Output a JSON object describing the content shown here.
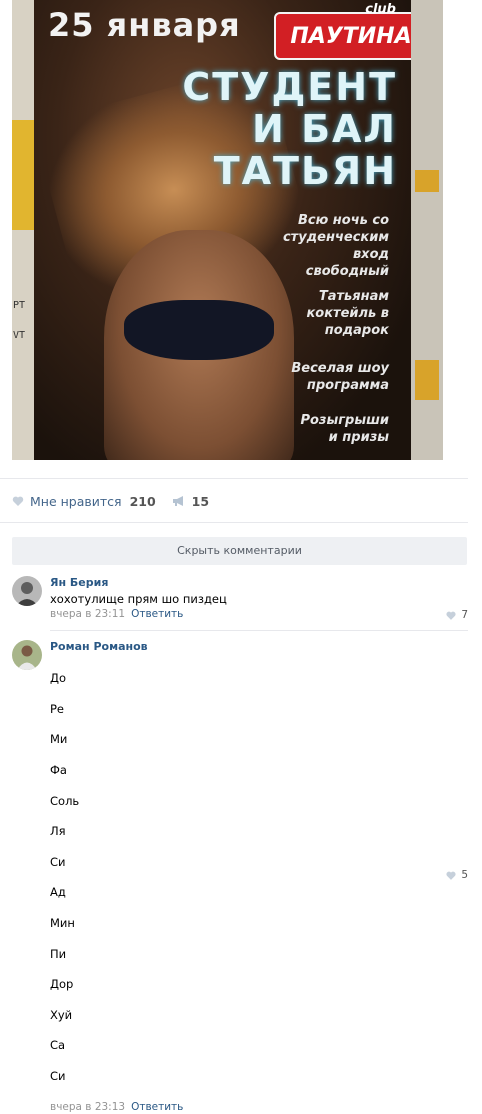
{
  "poster": {
    "date": "25 января",
    "club_small": "club",
    "club_name": "ПАУТИНА",
    "title_lines": [
      "СТУДЕНТ",
      "И БАЛ",
      "ТАТЬЯН"
    ],
    "info_1": "Всю ночь со студенческим вход свободный",
    "info_2": "Татьянам коктейль в подарок",
    "info_3": "Веселая шоу программа",
    "info_4": "Розыгрыши и призы"
  },
  "actions": {
    "like_label": "Мне нравится",
    "like_count": "210",
    "share_count": "15"
  },
  "hide_comments_label": "Скрыть комментарии",
  "comments": [
    {
      "author": "Ян Берия",
      "text": "хохотулище прям шо пиздец",
      "time": "вчера в 23:11",
      "reply_label": "Ответить",
      "likes": "7"
    },
    {
      "author": "Роман Романов",
      "lines": [
        "До",
        "Ре",
        "Ми",
        "Фа",
        "Соль",
        "Ля",
        "Си",
        "Ад",
        "Мин",
        "Пи",
        "Дор",
        "Хуй",
        "Са",
        "Си"
      ],
      "time": "вчера в 23:13",
      "reply_label": "Ответить",
      "likes": "5"
    }
  ],
  "colors": {
    "link": "#2a5885",
    "meta": "#939393",
    "button_bg": "#eef0f3"
  }
}
